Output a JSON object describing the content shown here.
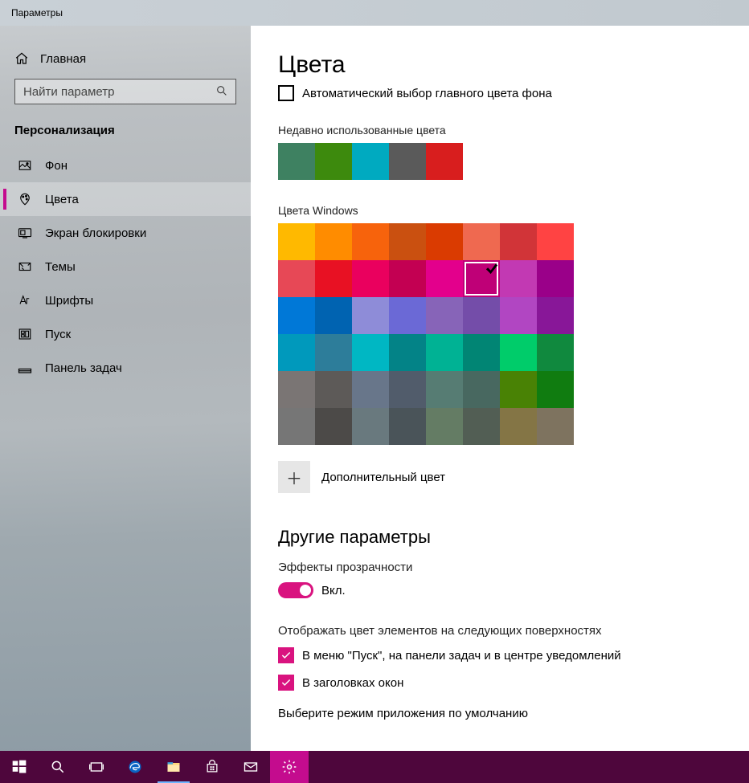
{
  "titlebar": {
    "title": "Параметры"
  },
  "sidebar": {
    "home": "Главная",
    "search_placeholder": "Найти параметр",
    "category": "Персонализация",
    "items": [
      {
        "label": "Фон"
      },
      {
        "label": "Цвета",
        "selected": true
      },
      {
        "label": "Экран блокировки"
      },
      {
        "label": "Темы"
      },
      {
        "label": "Шрифты"
      },
      {
        "label": "Пуск"
      },
      {
        "label": "Панель задач"
      }
    ]
  },
  "main": {
    "title": "Цвета",
    "auto_color_label": "Автоматический выбор главного цвета фона",
    "recent_label": "Недавно использованные цвета",
    "recent": [
      "#3e8161",
      "#3d8a0d",
      "#00aac0",
      "#5a5a5a",
      "#d81e1e"
    ],
    "windows_label": "Цвета Windows",
    "windows": [
      "#ffb900",
      "#ff8c00",
      "#f7630c",
      "#ca5010",
      "#da3b01",
      "#ef6950",
      "#d13438",
      "#ff4343",
      "#e74856",
      "#e81123",
      "#ea005e",
      "#c30052",
      "#e3008c",
      "#bf0077",
      "#c239b3",
      "#9a0089",
      "#0078d7",
      "#0063b1",
      "#8e8cd8",
      "#6b69d6",
      "#8764b8",
      "#744da9",
      "#b146c2",
      "#881798",
      "#0099bc",
      "#2d7d9a",
      "#00b7c3",
      "#038387",
      "#00b294",
      "#018574",
      "#00cc6a",
      "#10893e",
      "#7a7574",
      "#5d5a58",
      "#68768a",
      "#515c6b",
      "#567c73",
      "#486860",
      "#498205",
      "#107c10",
      "#767676",
      "#4c4a48",
      "#69797e",
      "#4a5459",
      "#647c64",
      "#525e54",
      "#847545",
      "#7e735f"
    ],
    "selected_windows_index": 13,
    "custom_color_label": "Дополнительный цвет",
    "other_params": "Другие параметры",
    "transparency_label": "Эффекты прозрачности",
    "transparency_state": "Вкл.",
    "surfaces_label": "Отображать цвет элементов на следующих поверхностях",
    "surface_opts": [
      "В меню \"Пуск\", на панели задач и в центре уведомлений",
      "В заголовках окон"
    ],
    "mode_label": "Выберите режим приложения по умолчанию"
  }
}
